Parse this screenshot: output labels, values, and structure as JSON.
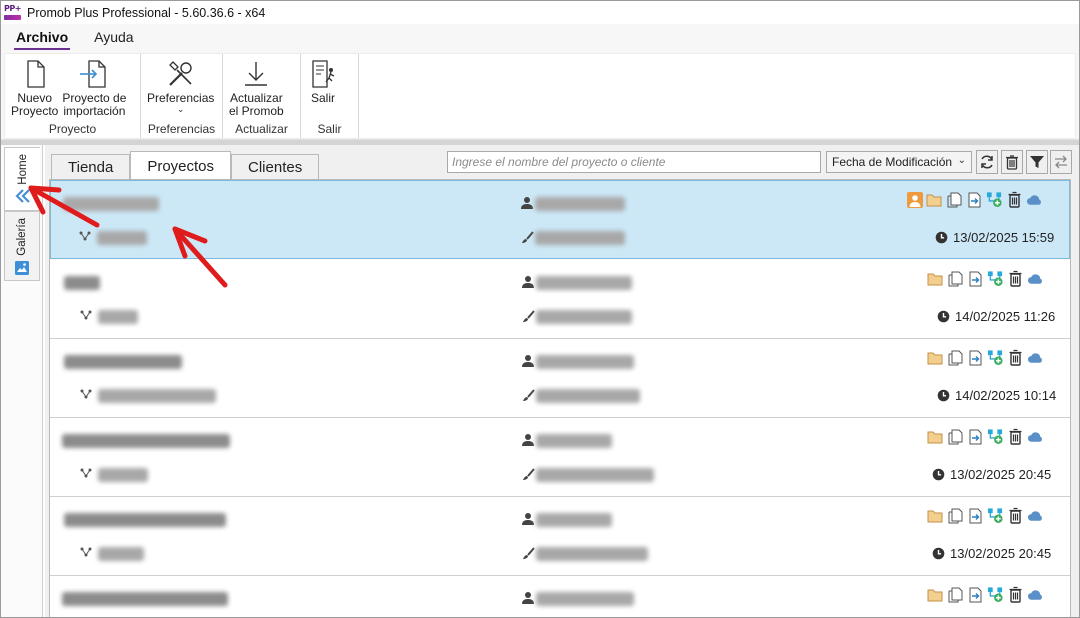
{
  "window": {
    "title": "Promob Plus Professional - 5.60.36.6 - x64",
    "logo_text": "PP+"
  },
  "menu": {
    "tabs": [
      {
        "label": "Archivo",
        "active": true
      },
      {
        "label": "Ayuda",
        "active": false
      }
    ]
  },
  "ribbon": {
    "groups": [
      {
        "label": "Proyecto",
        "buttons": [
          {
            "label": "Nuevo\nProyecto",
            "icon": "new-document-icon"
          },
          {
            "label": "Proyecto de\nimportación",
            "icon": "import-project-icon"
          }
        ]
      },
      {
        "label": "Preferencias",
        "buttons": [
          {
            "label": "Preferencias",
            "icon": "tools-icon",
            "dropdown": "⌄"
          }
        ]
      },
      {
        "label": "Actualizar",
        "buttons": [
          {
            "label": "Actualizar\nel Promob",
            "icon": "download-icon"
          }
        ]
      },
      {
        "label": "Salir",
        "buttons": [
          {
            "label": "Salir",
            "icon": "exit-icon"
          }
        ]
      }
    ]
  },
  "side_tabs": [
    {
      "label": "Home",
      "active": true
    },
    {
      "label": "Galería",
      "active": false
    }
  ],
  "project_tabs": [
    {
      "label": "Tienda",
      "active": false
    },
    {
      "label": "Proyectos",
      "active": true
    },
    {
      "label": "Clientes",
      "active": false
    }
  ],
  "search": {
    "placeholder": "Ingrese el nombre del proyecto o cliente"
  },
  "sort": {
    "selected": "Fecha de Modificación",
    "arrow": "⌄"
  },
  "projects": [
    {
      "date": "13/02/2025 15:59",
      "selected": true
    },
    {
      "date": "14/02/2025 11:26",
      "selected": false
    },
    {
      "date": "14/02/2025 10:14",
      "selected": false
    },
    {
      "date": "13/02/2025 20:45",
      "selected": false
    },
    {
      "date": "13/02/2025 20:45",
      "selected": false
    },
    {
      "date": "",
      "selected": false
    }
  ],
  "colors": {
    "accent": "#6b2f8f",
    "selected_row": "#cce8f6",
    "annotation": "#e01b1b",
    "folder": "#e9b56a",
    "cloud": "#5b8fc7",
    "share": "#2aa8d8"
  }
}
